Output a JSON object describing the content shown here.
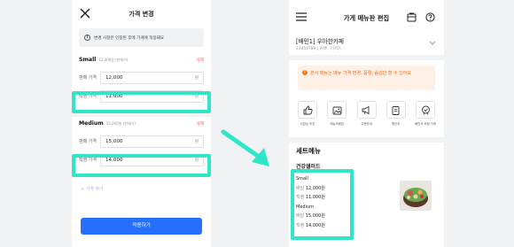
{
  "left_screen": {
    "title": "가격 변경",
    "notice": "변경 사항은 인정된 후에 가게에 적용돼요",
    "sections": [
      {
        "name": "Small",
        "sub": "12,000원 (판매가)",
        "delete": "삭제",
        "list_label": "판매 가격",
        "list_value": "12,000",
        "real_label": "직영 가격",
        "real_value": "11,000",
        "unit": "원"
      },
      {
        "name": "Medium",
        "sub": "15,000원 (판매가)",
        "delete": "삭제",
        "list_label": "판매 가격",
        "list_value": "15,000",
        "real_label": "직영 가격",
        "real_value": "14,000",
        "unit": "원"
      }
    ],
    "add_price": "+ 가격 추가",
    "apply_button": "적용하기"
  },
  "right_screen": {
    "title": "가게 메뉴판 편집",
    "shop_name": "[배민1] 우아한카페",
    "shop_sub": "23456789 | 카페 · 디저트",
    "alert": "본사 메뉴는 메뉴 가격 변경, 품절, 숨김만 할 수 있어요",
    "icons": [
      {
        "label": "사장님 추천",
        "icon": "thumbs-up-icon"
      },
      {
        "label": "메뉴모음집",
        "icon": "photo-album-icon"
      },
      {
        "label": "주문안내",
        "icon": "megaphone-icon"
      },
      {
        "label": "원산지",
        "icon": "clipboard-icon"
      },
      {
        "label": "배민서 요청 가게",
        "icon": "check-badge-icon"
      }
    ],
    "set_menu_title": "세트메뉴",
    "menu_name": "건강샐러드",
    "options": [
      {
        "size": "Small",
        "list_label": "배달",
        "list_price": "12,000원",
        "real_label": "직영",
        "real_price": "11,000원"
      },
      {
        "size": "Medium",
        "list_label": "배달",
        "list_price": "15,000원",
        "real_label": "직영",
        "real_price": "14,000원"
      }
    ]
  },
  "colors": {
    "highlight": "#2fe6c8",
    "primary_button": "#2770ff",
    "delete_text": "#f15b4d",
    "alert_text": "#ee6b18",
    "alert_bg": "#fdf0e6"
  }
}
